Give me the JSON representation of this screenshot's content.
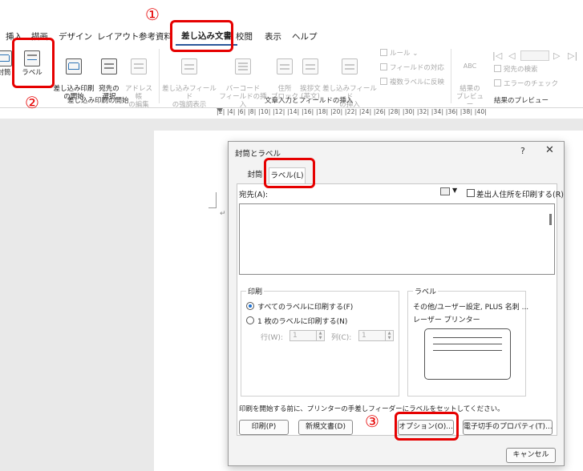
{
  "ribbon_tabs": [
    "挿入",
    "描画",
    "デザイン",
    "レイアウト",
    "参考資料",
    "差し込み文書",
    "校閲",
    "表示",
    "ヘルプ"
  ],
  "active_tab": "差し込み文書",
  "ribbon": {
    "envelope": "封筒",
    "label": "ラベル",
    "start_merge": "差し込み印刷\nの開始",
    "select_recipients": "宛先の\n選択",
    "edit_address_book": "アドレス帳\nの編集",
    "highlight_fields": "差し込みフィールド\nの強調表示",
    "barcode_field": "バーコード\nフィールドの挿入",
    "address_block": "住所\nブロック",
    "greeting": "挨拶文\n(英文)",
    "insert_merge_field": "差し込みフィールド\nの挿入",
    "rules": "ルール",
    "match_fields": "フィールドの対応",
    "update_labels": "複数ラベルに反映",
    "preview_results": "結果の\nプレビュー",
    "find_recipient": "宛先の検索",
    "check_errors": "エラーのチェック",
    "group_start": "差し込み印刷の開始",
    "group_insert": "文章入力とフィールドの挿入",
    "group_preview": "結果のプレビュー"
  },
  "ruler_text": "|2| |4| |6| |8| |10| |12| |14| |16| |18| |20| |22| |24| |26| |28| |30| |32| |34| |36| |38| |40|",
  "dialog": {
    "title": "封筒とラベル",
    "help": "?",
    "close": "✕",
    "tab_envelope": "封筒",
    "tab_label": "ラベル(L)",
    "address_label": "宛先(A):",
    "return_address": "差出人住所を印刷する(R)",
    "print_group": "印刷",
    "print_all": "すべてのラベルに印刷する(F)",
    "print_single": "1 枚のラベルに印刷する(N)",
    "row_label": "行(W):",
    "row_value": "1",
    "col_label": "列(C):",
    "col_value": "1",
    "label_group": "ラベル",
    "label_desc": "その他/ユーザー設定, PLUS 名刺 ...",
    "printer_type": "レーザー プリンター",
    "info": "印刷を開始する前に、プリンターの手差しフィーダーにラベルをセットしてください。",
    "btn_print": "印刷(P)",
    "btn_new_doc": "新規文書(D)",
    "btn_options": "オプション(O)...",
    "btn_postage": "電子切手のプロパティ(T)...",
    "btn_cancel": "キャンセル"
  },
  "annotations": {
    "step1": "①",
    "step2": "②",
    "step3": "③"
  },
  "colors": {
    "highlight": "#e60000",
    "accent": "#2b579a"
  }
}
